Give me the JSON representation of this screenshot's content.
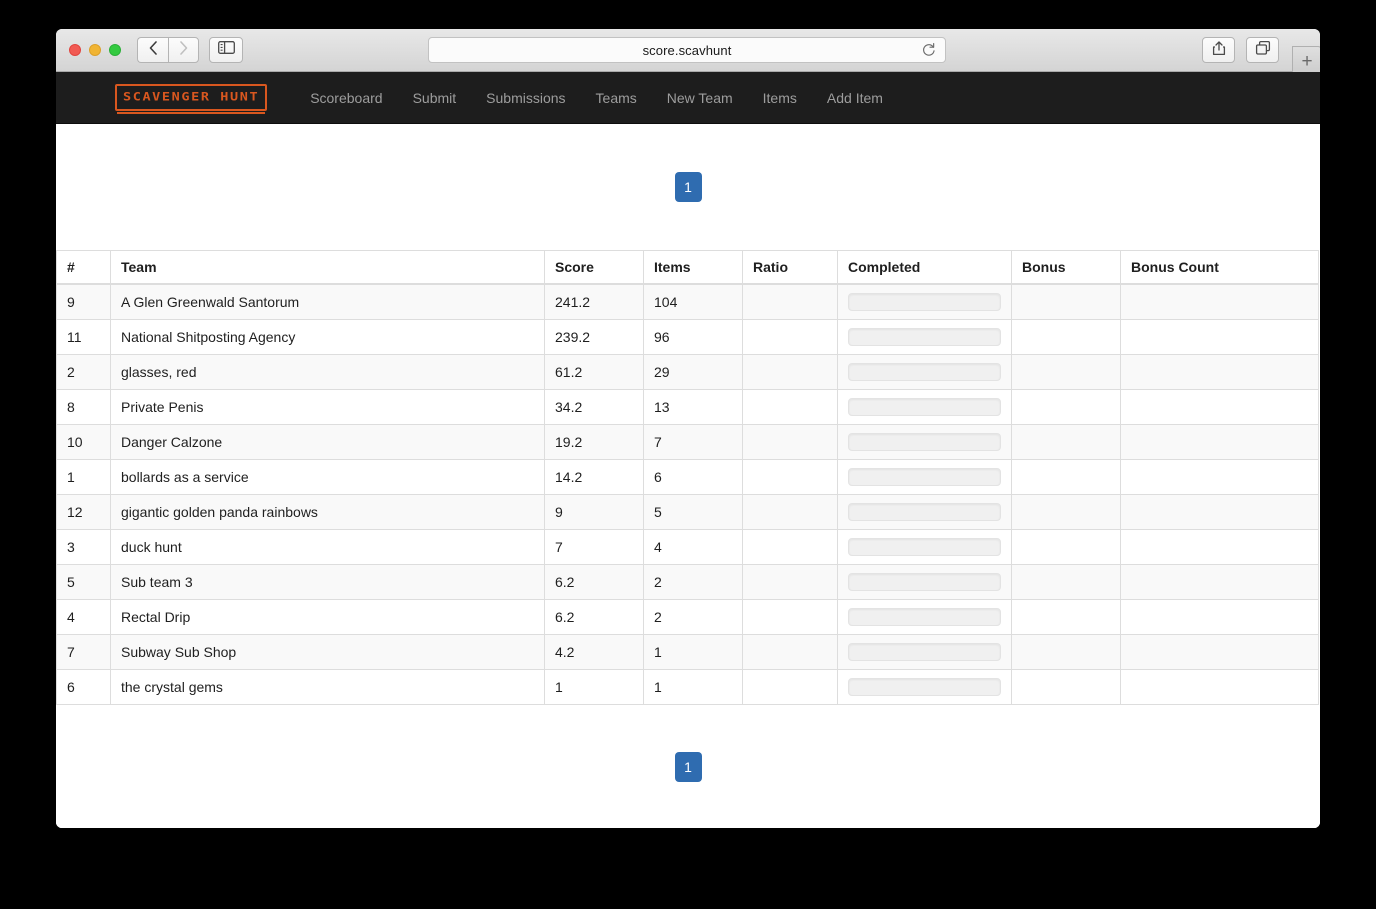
{
  "browser": {
    "url": "score.scavhunt",
    "back_icon": "chevron-left-icon",
    "forward_icon": "chevron-right-icon",
    "sidebar_icon": "sidebar-toggle-icon",
    "reload_icon": "reload-icon",
    "share_icon": "share-icon",
    "tabs_icon": "show-tabs-icon",
    "new_tab_label": "+"
  },
  "navbar": {
    "brand": "SCAVENGER HUNT",
    "links": [
      {
        "label": "Scoreboard"
      },
      {
        "label": "Submit"
      },
      {
        "label": "Submissions"
      },
      {
        "label": "Teams"
      },
      {
        "label": "New Team"
      },
      {
        "label": "Items"
      },
      {
        "label": "Add Item"
      }
    ]
  },
  "pagination": {
    "current_page": "1"
  },
  "scoreboard": {
    "columns": [
      "#",
      "Team",
      "Score",
      "Items",
      "Ratio",
      "Completed",
      "Bonus",
      "Bonus Count"
    ],
    "rows": [
      {
        "rank": "9",
        "team": "A Glen Greenwald Santorum",
        "score": "241.2",
        "items": "104",
        "ratio": "",
        "completed": "",
        "bonus": "",
        "bonus_count": ""
      },
      {
        "rank": "11",
        "team": "National Shitposting Agency",
        "score": "239.2",
        "items": "96",
        "ratio": "",
        "completed": "",
        "bonus": "",
        "bonus_count": ""
      },
      {
        "rank": "2",
        "team": "glasses, red",
        "score": "61.2",
        "items": "29",
        "ratio": "",
        "completed": "",
        "bonus": "",
        "bonus_count": ""
      },
      {
        "rank": "8",
        "team": "Private Penis",
        "score": "34.2",
        "items": "13",
        "ratio": "",
        "completed": "",
        "bonus": "",
        "bonus_count": ""
      },
      {
        "rank": "10",
        "team": "Danger Calzone",
        "score": "19.2",
        "items": "7",
        "ratio": "",
        "completed": "",
        "bonus": "",
        "bonus_count": ""
      },
      {
        "rank": "1",
        "team": "bollards as a service",
        "score": "14.2",
        "items": "6",
        "ratio": "",
        "completed": "",
        "bonus": "",
        "bonus_count": ""
      },
      {
        "rank": "12",
        "team": "gigantic golden panda rainbows",
        "score": "9",
        "items": "5",
        "ratio": "",
        "completed": "",
        "bonus": "",
        "bonus_count": ""
      },
      {
        "rank": "3",
        "team": "duck hunt",
        "score": "7",
        "items": "4",
        "ratio": "",
        "completed": "",
        "bonus": "",
        "bonus_count": ""
      },
      {
        "rank": "5",
        "team": "Sub team 3",
        "score": "6.2",
        "items": "2",
        "ratio": "",
        "completed": "",
        "bonus": "",
        "bonus_count": ""
      },
      {
        "rank": "4",
        "team": "Rectal Drip",
        "score": "6.2",
        "items": "2",
        "ratio": "",
        "completed": "",
        "bonus": "",
        "bonus_count": ""
      },
      {
        "rank": "7",
        "team": "Subway Sub Shop",
        "score": "4.2",
        "items": "1",
        "ratio": "",
        "completed": "",
        "bonus": "",
        "bonus_count": ""
      },
      {
        "rank": "6",
        "team": "the crystal gems",
        "score": "1",
        "items": "1",
        "ratio": "",
        "completed": "",
        "bonus": "",
        "bonus_count": ""
      }
    ]
  },
  "colors": {
    "brand_orange": "#d9571f",
    "navbar_bg": "#1d1d1d",
    "pagination_blue": "#2f6cb0",
    "row_stripe": "#f9f9f9",
    "table_border": "#dddddd"
  }
}
